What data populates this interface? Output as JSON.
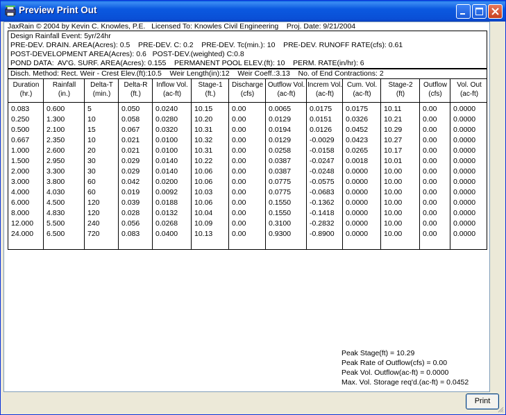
{
  "window": {
    "title": "Preview Print Out",
    "icon": "print-preview-icon"
  },
  "header": {
    "credit": "JaxRain © 2004 by Kevin C. Knowles, P.E.   Licensed To: Knowles Civil Engineering    Proj. Date: 9/21/2004",
    "design_lines": [
      "Design Rainfall Event: 5yr/24hr",
      "PRE-DEV. DRAIN. AREA(Acres): 0.5    PRE-DEV. C: 0.2    PRE-DEV. Tc(min.): 10    PRE-DEV. RUNOFF RATE(cfs): 0.61",
      "POST-DEVELOPMENT AREA(Acres): 0.6   POST-DEV.(weighted) C:0.8",
      "POND DATA:  AV'G. SURF. AREA(Acres): 0.155    PERMANENT POOL ELEV.(ft): 10    PERM. RATE(in/hr): 6"
    ],
    "method": "Disch. Method: Rect. Weir - Crest Elev.(ft):10.5    Weir Length(in):12    Weir Coeff.:3.13    No. of End Contractions: 2"
  },
  "table": {
    "columns": [
      {
        "line1": "Duration",
        "line2": "(hr.)"
      },
      {
        "line1": "Rainfall",
        "line2": "(in.)"
      },
      {
        "line1": "Delta-T",
        "line2": "(min.)"
      },
      {
        "line1": "Delta-R",
        "line2": "(ft.)"
      },
      {
        "line1": "Inflow Vol.",
        "line2": "(ac-ft)"
      },
      {
        "line1": "Stage-1",
        "line2": "(ft.)"
      },
      {
        "line1": "Discharge",
        "line2": "(cfs)"
      },
      {
        "line1": "Outflow Vol.",
        "line2": "(ac-ft)"
      },
      {
        "line1": "Increm Vol.",
        "line2": "(ac-ft)"
      },
      {
        "line1": "Cum. Vol.",
        "line2": "(ac-ft)"
      },
      {
        "line1": "Stage-2",
        "line2": "(ft)"
      },
      {
        "line1": "Outflow",
        "line2": "(cfs)"
      },
      {
        "line1": "Vol. Out",
        "line2": "(ac-ft)"
      }
    ],
    "rows": [
      [
        "0.083",
        "0.600",
        "5",
        "0.050",
        "0.0240",
        "10.15",
        "0.00",
        "0.0065",
        "0.0175",
        "0.0175",
        "10.11",
        "0.00",
        "0.0000"
      ],
      [
        "0.250",
        "1.300",
        "10",
        "0.058",
        "0.0280",
        "10.20",
        "0.00",
        "0.0129",
        "0.0151",
        "0.0326",
        "10.21",
        "0.00",
        "0.0000"
      ],
      [
        "0.500",
        "2.100",
        "15",
        "0.067",
        "0.0320",
        "10.31",
        "0.00",
        "0.0194",
        "0.0126",
        "0.0452",
        "10.29",
        "0.00",
        "0.0000"
      ],
      [
        "0.667",
        "2.350",
        "10",
        "0.021",
        "0.0100",
        "10.32",
        "0.00",
        "0.0129",
        "-0.0029",
        "0.0423",
        "10.27",
        "0.00",
        "0.0000"
      ],
      [
        "1.000",
        "2.600",
        "20",
        "0.021",
        "0.0100",
        "10.31",
        "0.00",
        "0.0258",
        "-0.0158",
        "0.0265",
        "10.17",
        "0.00",
        "0.0000"
      ],
      [
        "1.500",
        "2.950",
        "30",
        "0.029",
        "0.0140",
        "10.22",
        "0.00",
        "0.0387",
        "-0.0247",
        "0.0018",
        "10.01",
        "0.00",
        "0.0000"
      ],
      [
        "2.000",
        "3.300",
        "30",
        "0.029",
        "0.0140",
        "10.06",
        "0.00",
        "0.0387",
        "-0.0248",
        "0.0000",
        "10.00",
        "0.00",
        "0.0000"
      ],
      [
        "3.000",
        "3.800",
        "60",
        "0.042",
        "0.0200",
        "10.06",
        "0.00",
        "0.0775",
        "-0.0575",
        "0.0000",
        "10.00",
        "0.00",
        "0.0000"
      ],
      [
        "4.000",
        "4.030",
        "60",
        "0.019",
        "0.0092",
        "10.03",
        "0.00",
        "0.0775",
        "-0.0683",
        "0.0000",
        "10.00",
        "0.00",
        "0.0000"
      ],
      [
        "6.000",
        "4.500",
        "120",
        "0.039",
        "0.0188",
        "10.06",
        "0.00",
        "0.1550",
        "-0.1362",
        "0.0000",
        "10.00",
        "0.00",
        "0.0000"
      ],
      [
        "8.000",
        "4.830",
        "120",
        "0.028",
        "0.0132",
        "10.04",
        "0.00",
        "0.1550",
        "-0.1418",
        "0.0000",
        "10.00",
        "0.00",
        "0.0000"
      ],
      [
        "12.000",
        "5.500",
        "240",
        "0.056",
        "0.0268",
        "10.09",
        "0.00",
        "0.3100",
        "-0.2832",
        "0.0000",
        "10.00",
        "0.00",
        "0.0000"
      ],
      [
        "24.000",
        "6.500",
        "720",
        "0.083",
        "0.0400",
        "10.13",
        "0.00",
        "0.9300",
        "-0.8900",
        "0.0000",
        "10.00",
        "0.00",
        "0.0000"
      ]
    ]
  },
  "summary": {
    "peak_stage": "Peak Stage(ft) = 10.29",
    "peak_outflow_rate": "Peak Rate of Outflow(cfs) = 0.00",
    "peak_outflow_vol": "Peak Vol. Outflow(ac-ft) = 0.0000",
    "max_storage": "Max. Vol. Storage req'd.(ac-ft) = 0.0452"
  },
  "buttons": {
    "print": "Print"
  }
}
